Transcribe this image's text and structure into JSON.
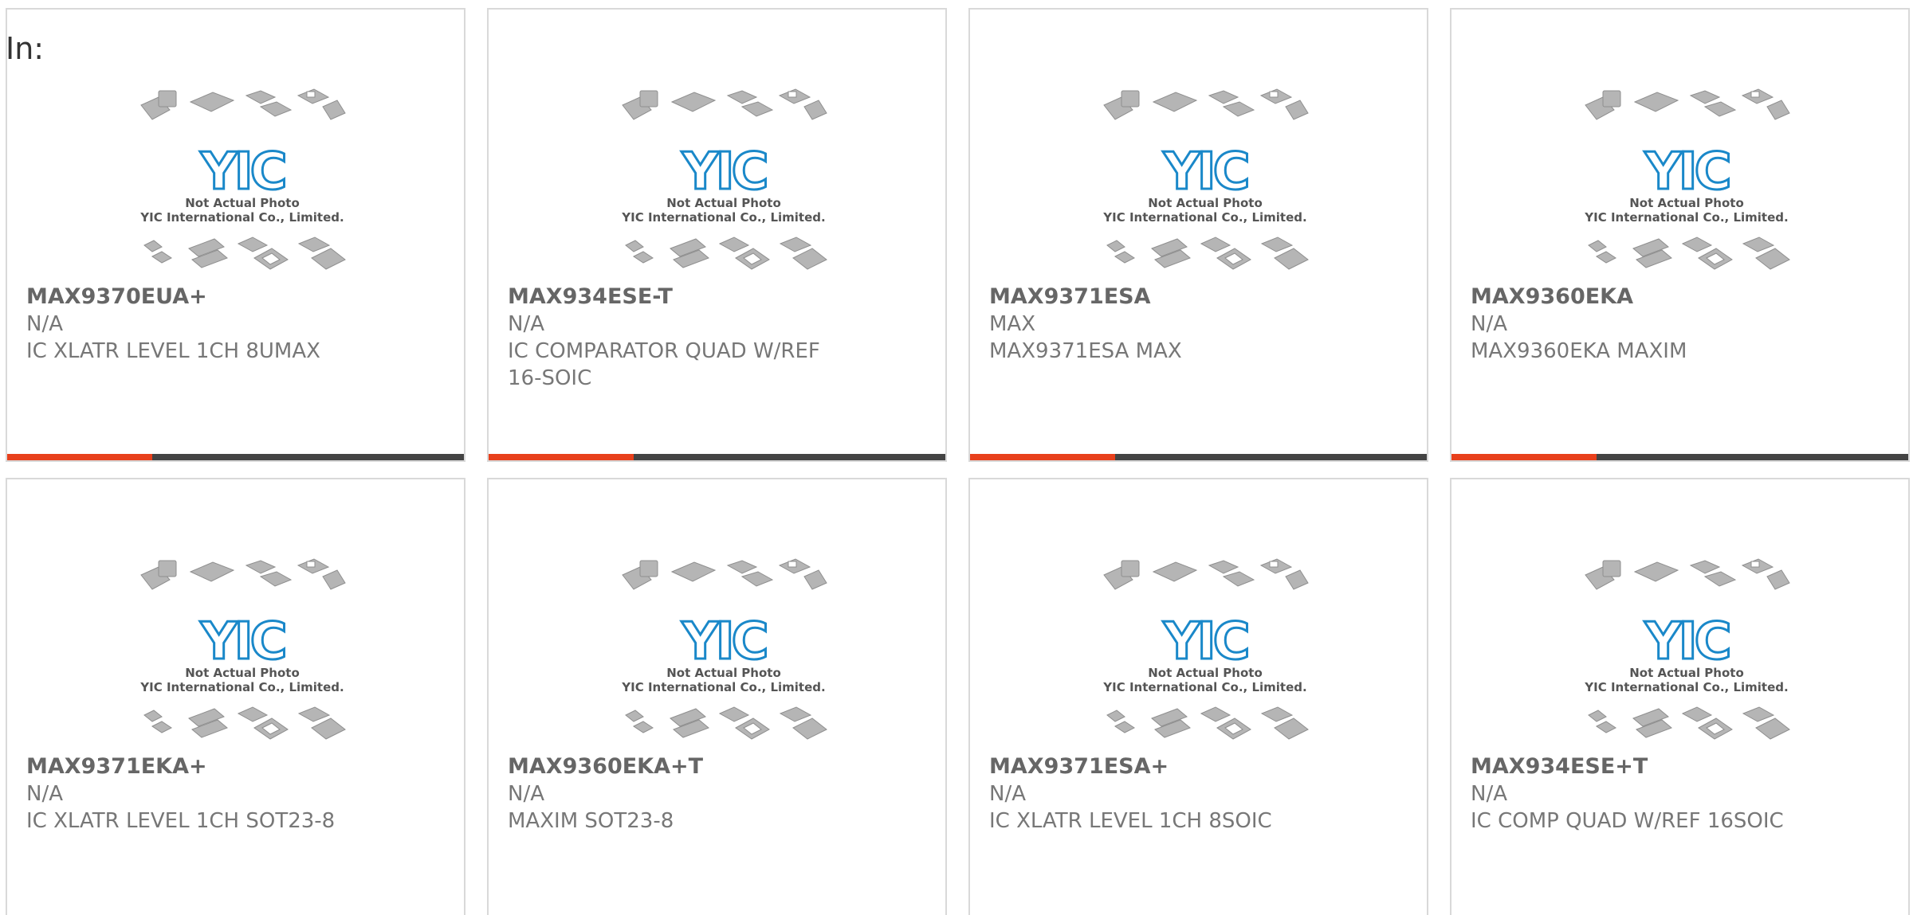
{
  "header": {
    "label": "In:"
  },
  "logo": {
    "brand_text": "YIC",
    "line1": "Not Actual Photo",
    "line2": "YIC International Co., Limited.",
    "brand_color": "#1a88c9"
  },
  "colors": {
    "accent_red": "#e8401c",
    "bar_dark": "#444444",
    "border": "#d9d9d9"
  },
  "products": [
    {
      "name": "MAX9370EUA+",
      "manufacturer": "N/A",
      "description": "IC XLATR LEVEL 1CH 8UMAX"
    },
    {
      "name": "MAX934ESE-T",
      "manufacturer": "N/A",
      "description": "IC COMPARATOR QUAD W/REF 16-SOIC"
    },
    {
      "name": "MAX9371ESA",
      "manufacturer": "MAX",
      "description": "MAX9371ESA MAX"
    },
    {
      "name": "MAX9360EKA",
      "manufacturer": "N/A",
      "description": "MAX9360EKA MAXIM"
    },
    {
      "name": "MAX9371EKA+",
      "manufacturer": "N/A",
      "description": "IC XLATR LEVEL 1CH SOT23-8"
    },
    {
      "name": "MAX9360EKA+T",
      "manufacturer": "N/A",
      "description": "MAXIM SOT23-8"
    },
    {
      "name": "MAX9371ESA+",
      "manufacturer": "N/A",
      "description": "IC XLATR LEVEL 1CH 8SOIC"
    },
    {
      "name": "MAX934ESE+T",
      "manufacturer": "N/A",
      "description": "IC COMP QUAD W/REF 16SOIC"
    }
  ]
}
